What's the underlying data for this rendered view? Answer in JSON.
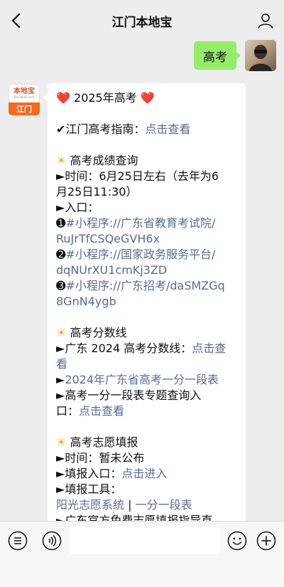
{
  "header": {
    "title": "江门本地宝"
  },
  "outgoing_message": {
    "text": "高考"
  },
  "bot_avatar": {
    "logo_text": "本地宝",
    "url_text": "Bendibao.com",
    "city": "江门"
  },
  "message": {
    "title": "2025年高考",
    "guide_prefix": "江门高考指南：",
    "guide_link": "点击查看",
    "score_query": {
      "heading": "高考成绩查询",
      "time_line1": "时间：6月25日左右（去年为6",
      "time_line2": "月25日11:30）",
      "entry_label": "入口：",
      "entry1_line1": "#小程序://广东省教育考试院/",
      "entry1_line2": "RuJrTfCSQeGVH6x",
      "entry2_line1": "#小程序://国家政务服务平台/",
      "entry2_line2": "dqNUrXU1cmKj3ZD",
      "entry3_line1": "#小程序://广东招考/daSMZGq",
      "entry3_line2": "8GnN4ygb"
    },
    "score_line": {
      "heading": "高考分数线",
      "item1_prefix": "广东 2024 高考分数线：",
      "item1_link_a": "点击查",
      "item1_link_b": "看",
      "item2_link": "2024年广东省高考一分一段表",
      "item3_line1": "高考一分一段表专题查询入",
      "item3_prefix": "口：",
      "item3_link": "点击查看"
    },
    "volunteer": {
      "heading": "高考志愿填报",
      "time": "时间：暂未公布",
      "entry_prefix": "填报入口：",
      "entry_link": "点击进入",
      "tools_label": "填报工具：",
      "tool1": "阳光志愿系统",
      "separator": " | ",
      "tool2": "一分一段表",
      "official_guide": "广东官方免费志愿填报指导直"
    }
  },
  "icons": {
    "back": "back-chevron-icon",
    "user": "user-icon",
    "list": "list-icon",
    "voice": "voice-icon",
    "emoji": "emoji-icon",
    "plus": "plus-icon",
    "heart": "❤️",
    "check": "✔",
    "sun": "☀",
    "arrow": "►",
    "num1": "➊",
    "num2": "➋",
    "num3": "➌"
  },
  "colors": {
    "outgoing_bubble": "#95ec69",
    "link": "#576b95",
    "brand_orange": "#f26b1d"
  }
}
